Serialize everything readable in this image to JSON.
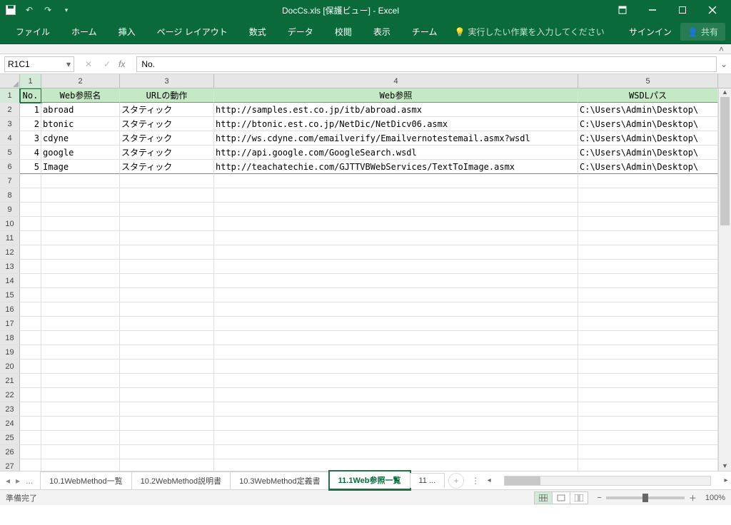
{
  "title": "DocCs.xls [保護ビュー] - Excel",
  "qat": {
    "save": "save",
    "undo": "undo",
    "redo": "redo"
  },
  "ribbon": {
    "file": "ファイル",
    "home": "ホーム",
    "insert": "挿入",
    "layout": "ページ レイアウト",
    "formulas": "数式",
    "data": "データ",
    "review": "校閲",
    "view": "表示",
    "team": "チーム",
    "tellme": "実行したい作業を入力してください",
    "signin": "サインイン",
    "share": "共有"
  },
  "namebox": "R1C1",
  "formula": "No.",
  "cols": {
    "c1": "1",
    "c2": "2",
    "c3": "3",
    "c4": "4",
    "c5": "5"
  },
  "colw": {
    "c1": 30,
    "c2": 110,
    "c3": 132,
    "c4": 510,
    "c5": 196
  },
  "header": {
    "no": "No.",
    "name": "Web参照名",
    "url": "URLの動作",
    "ref": "Web参照",
    "wsdl": "WSDLパス"
  },
  "data": [
    {
      "no": "1",
      "name": "abroad",
      "url": "スタティック",
      "ref": "http://samples.est.co.jp/itb/abroad.asmx",
      "wsdl": "C:\\Users\\Admin\\Desktop\\"
    },
    {
      "no": "2",
      "name": "btonic",
      "url": "スタティック",
      "ref": "http://btonic.est.co.jp/NetDic/NetDicv06.asmx",
      "wsdl": "C:\\Users\\Admin\\Desktop\\"
    },
    {
      "no": "3",
      "name": "cdyne",
      "url": "スタティック",
      "ref": "http://ws.cdyne.com/emailverify/Emailvernotestemail.asmx?wsdl",
      "wsdl": "C:\\Users\\Admin\\Desktop\\"
    },
    {
      "no": "4",
      "name": "google",
      "url": "スタティック",
      "ref": "http://api.google.com/GoogleSearch.wsdl",
      "wsdl": "C:\\Users\\Admin\\Desktop\\"
    },
    {
      "no": "5",
      "name": "Image",
      "url": "スタティック",
      "ref": "http://teachatechie.com/GJTTVBWebServices/TextToImage.asmx",
      "wsdl": "C:\\Users\\Admin\\Desktop\\"
    }
  ],
  "tabs": {
    "t1": "10.1WebMethod一覧",
    "t2": "10.2WebMethod説明書",
    "t3": "10.3WebMethod定義書",
    "t4": "11.1Web参照一覧",
    "t5": "11",
    "more": "...",
    "first": "...",
    "new": "+"
  },
  "status": {
    "ready": "準備完了",
    "zoom": "100%",
    "minus": "−",
    "plus": "＋"
  }
}
